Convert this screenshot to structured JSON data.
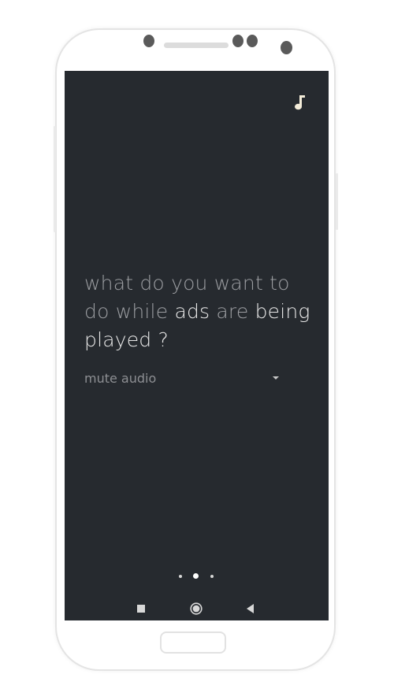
{
  "question": {
    "part1": "what do you want to do while ",
    "highlight1": "ads",
    "part2": " are ",
    "highlight2": "being played ?"
  },
  "dropdown": {
    "selected": "mute audio"
  },
  "pager": {
    "count": 3,
    "active_index": 1
  },
  "icons": {
    "top_right": "music-note-icon",
    "nav_recent": "recent-apps-icon",
    "nav_home": "home-icon",
    "nav_back": "back-icon",
    "dropdown": "caret-down-icon"
  },
  "colors": {
    "screen_bg": "#262a2f",
    "text_dim": "#9c9ea2",
    "text_highlight": "#e8e8e8",
    "music_icon": "#f3ecd9"
  }
}
